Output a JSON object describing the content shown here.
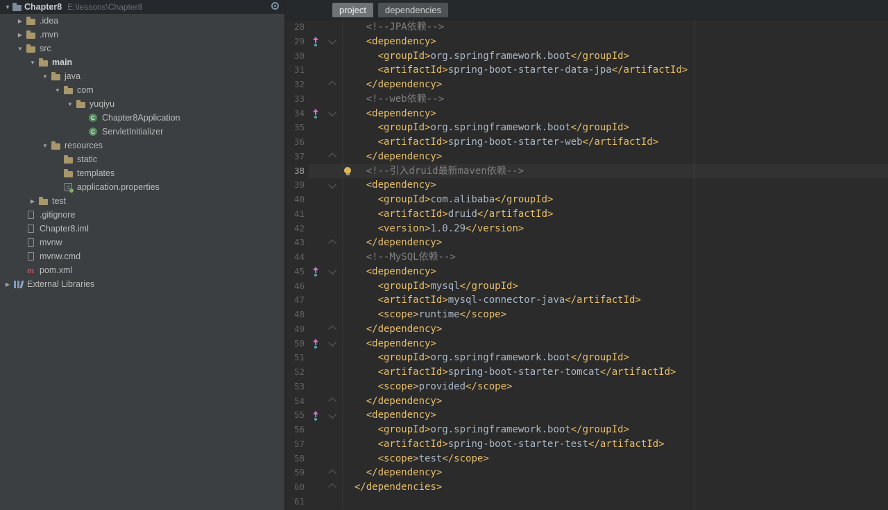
{
  "project_panel": {
    "root": {
      "name": "Chapter8",
      "path": "E:\\lessons\\Chapter8"
    },
    "tree": [
      {
        "label": ".idea",
        "level": 1,
        "chevron": "collapsed",
        "icon": "folder"
      },
      {
        "label": ".mvn",
        "level": 1,
        "chevron": "collapsed",
        "icon": "folder"
      },
      {
        "label": "src",
        "level": 1,
        "chevron": "expanded",
        "icon": "folder"
      },
      {
        "label": "main",
        "level": 2,
        "chevron": "expanded",
        "icon": "folder",
        "bold": true
      },
      {
        "label": "java",
        "level": 3,
        "chevron": "expanded",
        "icon": "folder"
      },
      {
        "label": "com",
        "level": 4,
        "chevron": "expanded",
        "icon": "folder"
      },
      {
        "label": "yuqiyu",
        "level": 5,
        "chevron": "expanded",
        "icon": "folder"
      },
      {
        "label": "Chapter8Application",
        "level": 6,
        "icon": "class"
      },
      {
        "label": "ServletInitializer",
        "level": 6,
        "icon": "class"
      },
      {
        "label": "resources",
        "level": 3,
        "chevron": "expanded",
        "icon": "folder"
      },
      {
        "label": "static",
        "level": 4,
        "icon": "folder"
      },
      {
        "label": "templates",
        "level": 4,
        "icon": "folder"
      },
      {
        "label": "application.properties",
        "level": 4,
        "icon": "properties"
      },
      {
        "label": "test",
        "level": 2,
        "chevron": "collapsed",
        "icon": "folder"
      },
      {
        "label": ".gitignore",
        "level": 1,
        "icon": "file"
      },
      {
        "label": "Chapter8.iml",
        "level": 1,
        "icon": "file"
      },
      {
        "label": "mvnw",
        "level": 1,
        "icon": "file"
      },
      {
        "label": "mvnw.cmd",
        "level": 1,
        "icon": "file"
      },
      {
        "label": "pom.xml",
        "level": 1,
        "icon": "maven"
      },
      {
        "label": "External Libraries",
        "level": 0,
        "chevron": "collapsed",
        "icon": "libraries"
      }
    ]
  },
  "breadcrumbs": {
    "items": [
      {
        "label": "project",
        "active": true
      },
      {
        "label": "dependencies",
        "active": false
      }
    ]
  },
  "editor": {
    "lines": [
      {
        "n": 28,
        "ind": 4,
        "seg": [
          [
            "c",
            "<!--JPA依赖-->"
          ]
        ]
      },
      {
        "n": 29,
        "ind": 4,
        "icon": true,
        "fold": "open",
        "seg": [
          [
            "g",
            "<dependency>"
          ]
        ]
      },
      {
        "n": 30,
        "ind": 6,
        "seg": [
          [
            "g",
            "<groupId>"
          ],
          [
            "x",
            "org.springframework.boot"
          ],
          [
            "g",
            "</groupId>"
          ]
        ]
      },
      {
        "n": 31,
        "ind": 6,
        "seg": [
          [
            "g",
            "<artifactId>"
          ],
          [
            "x",
            "spring-boot-starter-data-jpa"
          ],
          [
            "g",
            "</artifactId>"
          ]
        ]
      },
      {
        "n": 32,
        "ind": 4,
        "fold": "close",
        "seg": [
          [
            "g",
            "</dependency>"
          ]
        ]
      },
      {
        "n": 33,
        "ind": 4,
        "seg": [
          [
            "c",
            "<!--web依赖-->"
          ]
        ]
      },
      {
        "n": 34,
        "ind": 4,
        "icon": true,
        "fold": "open",
        "seg": [
          [
            "g",
            "<dependency>"
          ]
        ]
      },
      {
        "n": 35,
        "ind": 6,
        "seg": [
          [
            "g",
            "<groupId>"
          ],
          [
            "x",
            "org.springframework.boot"
          ],
          [
            "g",
            "</groupId>"
          ]
        ]
      },
      {
        "n": 36,
        "ind": 6,
        "seg": [
          [
            "g",
            "<artifactId>"
          ],
          [
            "x",
            "spring-boot-starter-web"
          ],
          [
            "g",
            "</artifactId>"
          ]
        ]
      },
      {
        "n": 37,
        "ind": 4,
        "fold": "close",
        "seg": [
          [
            "g",
            "</dependency>"
          ]
        ]
      },
      {
        "n": 38,
        "ind": 4,
        "current": true,
        "bulb": true,
        "seg": [
          [
            "c",
            "<!--引入druid最新maven依赖-->"
          ]
        ]
      },
      {
        "n": 39,
        "ind": 4,
        "fold": "open",
        "seg": [
          [
            "g",
            "<dependency>"
          ]
        ]
      },
      {
        "n": 40,
        "ind": 6,
        "seg": [
          [
            "g",
            "<groupId>"
          ],
          [
            "x",
            "com.alibaba"
          ],
          [
            "g",
            "</groupId>"
          ]
        ]
      },
      {
        "n": 41,
        "ind": 6,
        "seg": [
          [
            "g",
            "<artifactId>"
          ],
          [
            "x",
            "druid"
          ],
          [
            "g",
            "</artifactId>"
          ]
        ]
      },
      {
        "n": 42,
        "ind": 6,
        "seg": [
          [
            "g",
            "<version>"
          ],
          [
            "x",
            "1.0.29"
          ],
          [
            "g",
            "</version>"
          ]
        ]
      },
      {
        "n": 43,
        "ind": 4,
        "fold": "close",
        "seg": [
          [
            "g",
            "</dependency>"
          ]
        ]
      },
      {
        "n": 44,
        "ind": 4,
        "seg": [
          [
            "c",
            "<!--MySQL依赖-->"
          ]
        ]
      },
      {
        "n": 45,
        "ind": 4,
        "icon": true,
        "fold": "open",
        "seg": [
          [
            "g",
            "<dependency>"
          ]
        ]
      },
      {
        "n": 46,
        "ind": 6,
        "seg": [
          [
            "g",
            "<groupId>"
          ],
          [
            "x",
            "mysql"
          ],
          [
            "g",
            "</groupId>"
          ]
        ]
      },
      {
        "n": 47,
        "ind": 6,
        "seg": [
          [
            "g",
            "<artifactId>"
          ],
          [
            "x",
            "mysql-connector-java"
          ],
          [
            "g",
            "</artifactId>"
          ]
        ]
      },
      {
        "n": 48,
        "ind": 6,
        "seg": [
          [
            "g",
            "<scope>"
          ],
          [
            "x",
            "runtime"
          ],
          [
            "g",
            "</scope>"
          ]
        ]
      },
      {
        "n": 49,
        "ind": 4,
        "fold": "close",
        "seg": [
          [
            "g",
            "</dependency>"
          ]
        ]
      },
      {
        "n": 50,
        "ind": 4,
        "icon": true,
        "fold": "open",
        "seg": [
          [
            "g",
            "<dependency>"
          ]
        ]
      },
      {
        "n": 51,
        "ind": 6,
        "seg": [
          [
            "g",
            "<groupId>"
          ],
          [
            "x",
            "org.springframework.boot"
          ],
          [
            "g",
            "</groupId>"
          ]
        ]
      },
      {
        "n": 52,
        "ind": 6,
        "seg": [
          [
            "g",
            "<artifactId>"
          ],
          [
            "x",
            "spring-boot-starter-tomcat"
          ],
          [
            "g",
            "</artifactId>"
          ]
        ]
      },
      {
        "n": 53,
        "ind": 6,
        "seg": [
          [
            "g",
            "<scope>"
          ],
          [
            "x",
            "provided"
          ],
          [
            "g",
            "</scope>"
          ]
        ]
      },
      {
        "n": 54,
        "ind": 4,
        "fold": "close",
        "seg": [
          [
            "g",
            "</dependency>"
          ]
        ]
      },
      {
        "n": 55,
        "ind": 4,
        "icon": true,
        "fold": "open",
        "seg": [
          [
            "g",
            "<dependency>"
          ]
        ]
      },
      {
        "n": 56,
        "ind": 6,
        "seg": [
          [
            "g",
            "<groupId>"
          ],
          [
            "x",
            "org.springframework.boot"
          ],
          [
            "g",
            "</groupId>"
          ]
        ]
      },
      {
        "n": 57,
        "ind": 6,
        "seg": [
          [
            "g",
            "<artifactId>"
          ],
          [
            "x",
            "spring-boot-starter-test"
          ],
          [
            "g",
            "</artifactId>"
          ]
        ]
      },
      {
        "n": 58,
        "ind": 6,
        "seg": [
          [
            "g",
            "<scope>"
          ],
          [
            "x",
            "test"
          ],
          [
            "g",
            "</scope>"
          ]
        ]
      },
      {
        "n": 59,
        "ind": 4,
        "fold": "close",
        "seg": [
          [
            "g",
            "</dependency>"
          ]
        ]
      },
      {
        "n": 60,
        "ind": 2,
        "fold": "close",
        "seg": [
          [
            "g",
            "</dependencies>"
          ]
        ]
      },
      {
        "n": 61,
        "ind": 0,
        "seg": []
      }
    ]
  },
  "icons": {
    "expanded": "▼",
    "collapsed": "▶",
    "class_letter": "C",
    "maven_letter": "m"
  },
  "colors": {
    "tag": "#E8BF6A",
    "text": "#A9B7C6",
    "comment": "#808080",
    "editor_bg": "#2B2B2B",
    "panel_bg": "#3C3F41",
    "caret_row": "#323232",
    "gutter_icon_purple": "#C875C8",
    "bulb": "#E0B64B"
  }
}
